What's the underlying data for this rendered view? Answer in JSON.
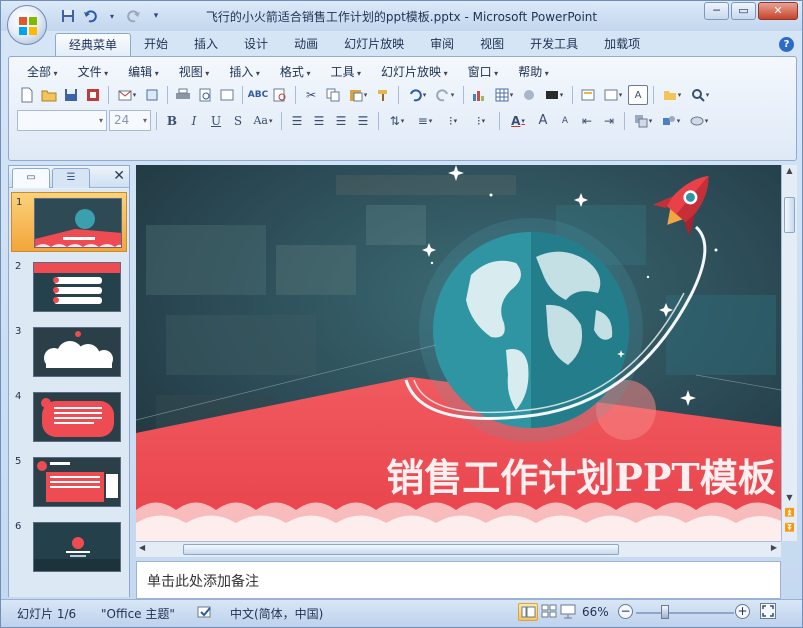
{
  "window": {
    "title": "飞行的小火箭适合销售工作计划的ppt模板.pptx - Microsoft PowerPoint",
    "controls": [
      "minimize-icon",
      "maximize-icon",
      "close-icon"
    ]
  },
  "quick_access": [
    "save-icon",
    "undo-icon",
    "redo-icon",
    "customize-icon"
  ],
  "ribbon": {
    "tabs": [
      "经典菜单",
      "开始",
      "插入",
      "设计",
      "动画",
      "幻灯片放映",
      "审阅",
      "视图",
      "开发工具",
      "加载项"
    ],
    "active_tab": "经典菜单",
    "menus": [
      "全部",
      "文件",
      "编辑",
      "视图",
      "插入",
      "格式",
      "工具",
      "幻灯片放映",
      "窗口",
      "帮助"
    ],
    "font_name": "",
    "font_size": "24"
  },
  "slides_panel": {
    "selected": 1,
    "slides": [
      "1",
      "2",
      "3",
      "4",
      "5",
      "6"
    ]
  },
  "slide": {
    "title_text": "销售工作计划PPT模板",
    "colors": {
      "red": "#ee4b52",
      "teal": "#2b8f9f",
      "dark": "#27444f"
    }
  },
  "notes": {
    "placeholder": "单击此处添加备注"
  },
  "status": {
    "slide_info": "幻灯片 1/6",
    "theme": "\"Office 主题\"",
    "language": "中文(简体，中国)",
    "zoom": "66%"
  }
}
